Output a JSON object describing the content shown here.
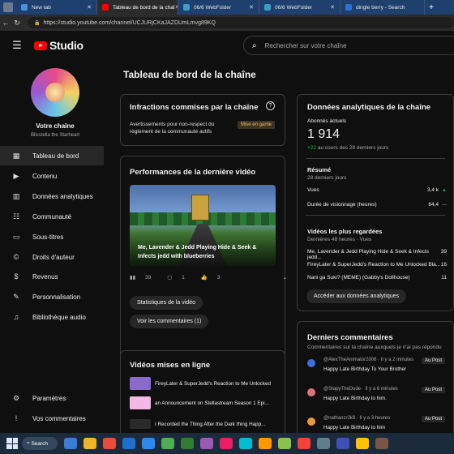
{
  "browser": {
    "tabs": [
      {
        "label": "New tab",
        "color": "#4a8fd9"
      },
      {
        "label": "Tableau de bord de la chaî",
        "color": "#ff0000",
        "active": true
      },
      {
        "label": "06/6 WebFolder",
        "color": "#3aa0c8"
      },
      {
        "label": "06/6 WebFolder",
        "color": "#3aa0c8"
      },
      {
        "label": "dingle berry - Search",
        "color": "#2f6fd6"
      }
    ],
    "new_tab_label": "+",
    "url": "https://studio.youtube.com/channel/UCJURjCKaJAZDUmLmvg89KQ"
  },
  "header": {
    "logo_text": "Studio",
    "search_placeholder": "Rechercher sur votre chaîne"
  },
  "sidebar": {
    "channel_title": "Votre chaîne",
    "channel_name": "Blisstella the Starheart",
    "items": [
      {
        "label": "Tableau de bord",
        "icon": "▦",
        "active": true
      },
      {
        "label": "Contenu",
        "icon": "▶"
      },
      {
        "label": "Données analytiques",
        "icon": "▥"
      },
      {
        "label": "Communauté",
        "icon": "☷"
      },
      {
        "label": "Sous-titres",
        "icon": "▭"
      },
      {
        "label": "Droits d'auteur",
        "icon": "©"
      },
      {
        "label": "Revenus",
        "icon": "$"
      },
      {
        "label": "Personnalisation",
        "icon": "✎"
      },
      {
        "label": "Bibliothèque audio",
        "icon": "♫"
      }
    ],
    "bottom_items": [
      {
        "label": "Paramètres",
        "icon": "⚙"
      },
      {
        "label": "Vos commentaires",
        "icon": "!"
      }
    ]
  },
  "main": {
    "page_title": "Tableau de bord de la chaîne",
    "infractions": {
      "title": "Infractions commises par la chaîne",
      "text": "Avertissements pour non-respect du règlement de la communauté actifs",
      "badge": "Mise en garde"
    },
    "performance": {
      "title": "Performances de la dernière vidéo",
      "video_title": "Me, Lavender & Jedd Playing Hide & Seek & Infects jedd with blueberries",
      "views": "39",
      "comments": "1",
      "likes": "3",
      "btn_stats": "Statistiques de la vidéo",
      "btn_comments": "Voir les commentaires (1)"
    },
    "uploads": {
      "title": "Vidéos mises en ligne",
      "items": [
        {
          "title": "FireyLater & SuperJedd's Reaction to Me Unlocked",
          "color": "#8a6bc9"
        },
        {
          "title": "an Announcement on Stellastream Season 1 Epi...",
          "color": "#f3b8e4"
        },
        {
          "title": "I Recorded the Thing After the Dark thing Happ...",
          "color": "#2a2a2a"
        }
      ]
    },
    "analytics": {
      "title": "Données analytiques de la chaîne",
      "subscribers_label": "Abonnés actuels",
      "subscribers": "1 914",
      "delta": "+22",
      "delta_text": "au cours des 28 derniers jours",
      "summary_title": "Résumé",
      "summary_sub": "28 derniers jours",
      "views_label": "Vues",
      "views_value": "3,4 k",
      "watch_label": "Durée de visionnage (heures)",
      "watch_value": "84,4",
      "top_title": "Vidéos les plus regardées",
      "top_sub": "Dernières 48 heures · Vues",
      "top_videos": [
        {
          "title": "Me, Lavender & Jedd Playing Hide & Seek & Infects jedd...",
          "views": "39"
        },
        {
          "title": "FireyLater & SuperJedd's Reaction to Me Unlocked Bla...",
          "views": "16"
        },
        {
          "title": "Nani ga Suki? (MEME) (Gabby's Dollhouse)",
          "views": "11"
        }
      ],
      "button": "Accéder aux données analytiques"
    },
    "comments": {
      "title": "Derniers commentaires",
      "subtitle": "Commentaires sur la chaîne auxquels je n'ai pas répondu",
      "items": [
        {
          "author": "@AlexTheAnimator2008 · Il y a 2 minutes",
          "text": "Happy Late Birthday To Your Brother",
          "post": "Au Post",
          "color": "#3d6fd6"
        },
        {
          "author": "@StapyTheDude · Il y a 6 minutes",
          "text": "Happy Late Birthday to him.",
          "post": "Au Post",
          "color": "#e0707a"
        },
        {
          "author": "@nathanzr2k9 · Il y a 3 heures",
          "text": "Happy Late Birthday to him",
          "post": "Au Post",
          "color": "#e89a3a"
        }
      ]
    }
  },
  "taskbar": {
    "search_label": "Search",
    "apps": [
      "#3a7bd5",
      "#f0b429",
      "#e74c3c",
      "#1f6fd1",
      "#2d89ef",
      "#4caf50",
      "#2e7d32",
      "#9b59b6",
      "#e91e63",
      "#00bcd4",
      "#ff9800",
      "#8bc34a",
      "#f44336",
      "#607d8b",
      "#3f51b5",
      "#ffc107",
      "#795548"
    ]
  }
}
